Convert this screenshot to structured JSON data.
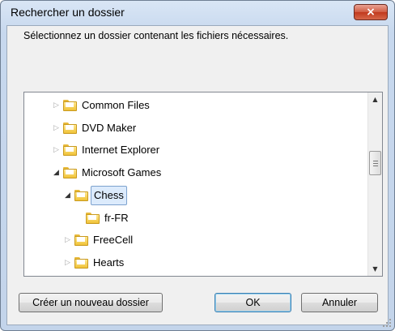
{
  "dialog": {
    "title": "Rechercher un dossier",
    "close_label": "×",
    "instruction": "Sélectionnez un dossier contenant les fichiers nécessaires."
  },
  "tree": {
    "items": [
      {
        "label": "Common Files",
        "expanded": false,
        "has_children": true,
        "level": 1,
        "selected": false
      },
      {
        "label": "DVD Maker",
        "expanded": false,
        "has_children": true,
        "level": 1,
        "selected": false
      },
      {
        "label": "Internet Explorer",
        "expanded": false,
        "has_children": true,
        "level": 1,
        "selected": false
      },
      {
        "label": "Microsoft Games",
        "expanded": true,
        "has_children": true,
        "level": 1,
        "selected": false
      },
      {
        "label": "Chess",
        "expanded": true,
        "has_children": true,
        "level": 2,
        "selected": true
      },
      {
        "label": "fr-FR",
        "expanded": false,
        "has_children": false,
        "level": 3,
        "selected": false
      },
      {
        "label": "FreeCell",
        "expanded": false,
        "has_children": true,
        "level": 2,
        "selected": false
      },
      {
        "label": "Hearts",
        "expanded": false,
        "has_children": true,
        "level": 2,
        "selected": false
      }
    ],
    "scroll_up_glyph": "▲",
    "scroll_down_glyph": "▼"
  },
  "buttons": {
    "new_folder": "Créer un nouveau dossier",
    "ok": "OK",
    "cancel": "Annuler"
  },
  "colors": {
    "selection_fill": "#dcebfc",
    "selection_border": "#7da2ce",
    "close_button": "#c1391d",
    "folder": "#f0c238"
  }
}
